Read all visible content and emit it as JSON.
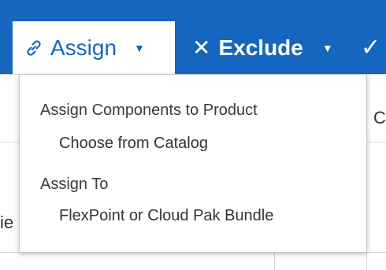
{
  "toolbar": {
    "assign_label": "Assign",
    "exclude_label": "Exclude",
    "accent_color": "#1566bf",
    "icons": [
      "link-icon",
      "close-icon",
      "check-icon",
      "caret-down-icon"
    ]
  },
  "background": {
    "col_text": "C",
    "row_text": "ie"
  },
  "menu": {
    "groups": [
      {
        "title": "Assign Components to Product",
        "items": [
          "Choose from Catalog"
        ]
      },
      {
        "title": "Assign To",
        "items": [
          "FlexPoint or Cloud Pak Bundle"
        ]
      }
    ]
  }
}
